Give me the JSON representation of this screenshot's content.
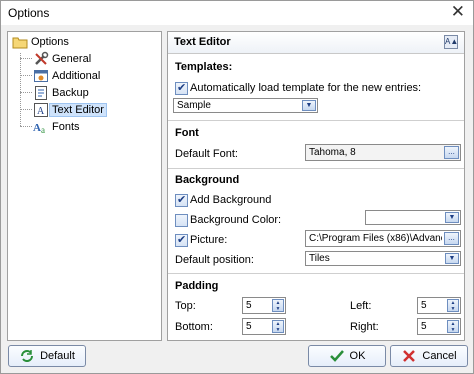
{
  "window": {
    "title": "Options",
    "close_glyph": "✕"
  },
  "tree": {
    "root": {
      "label": "Options",
      "icon": "folder-icon"
    },
    "items": [
      {
        "label": "General",
        "icon": "wrench-icon"
      },
      {
        "label": "Additional",
        "icon": "tools-icon"
      },
      {
        "label": "Backup",
        "icon": "backup-icon"
      },
      {
        "label": "Text Editor",
        "icon": "text-editor-icon",
        "selected": true
      },
      {
        "label": "Fonts",
        "icon": "fonts-icon"
      }
    ]
  },
  "panel": {
    "title": "Text Editor",
    "header_icon_glyph": "A▲",
    "templates": {
      "heading": "Templates:",
      "auto_load_label": "Automatically load template for the new entries:",
      "auto_load_checked": true,
      "template_value": "Sample"
    },
    "font": {
      "heading": "Font",
      "default_font_label": "Default Font:",
      "default_font_value": "Tahoma, 8"
    },
    "background": {
      "heading": "Background",
      "add_background_label": "Add Background",
      "add_background_checked": true,
      "color_label": "Background Color:",
      "color_checked": false,
      "color_value": "",
      "picture_label": "Picture:",
      "picture_checked": true,
      "picture_value": "C:\\Program Files (x86)\\Advanced D",
      "position_label": "Default position:",
      "position_value": "Tiles"
    },
    "padding": {
      "heading": "Padding",
      "top_label": "Top:",
      "top_value": "5",
      "bottom_label": "Bottom:",
      "bottom_value": "5",
      "left_label": "Left:",
      "left_value": "5",
      "right_label": "Right:",
      "right_value": "5"
    }
  },
  "buttons": {
    "default": "Default",
    "ok": "OK",
    "cancel": "Cancel"
  },
  "glyphs": {
    "dropdown": "▼",
    "ellipsis": "...",
    "spin_up": "▲",
    "spin_down": "▼"
  },
  "colors": {
    "accent": "#1e3f86",
    "selection": "#cfe3fb",
    "window_bg": "#f0f0f0"
  }
}
